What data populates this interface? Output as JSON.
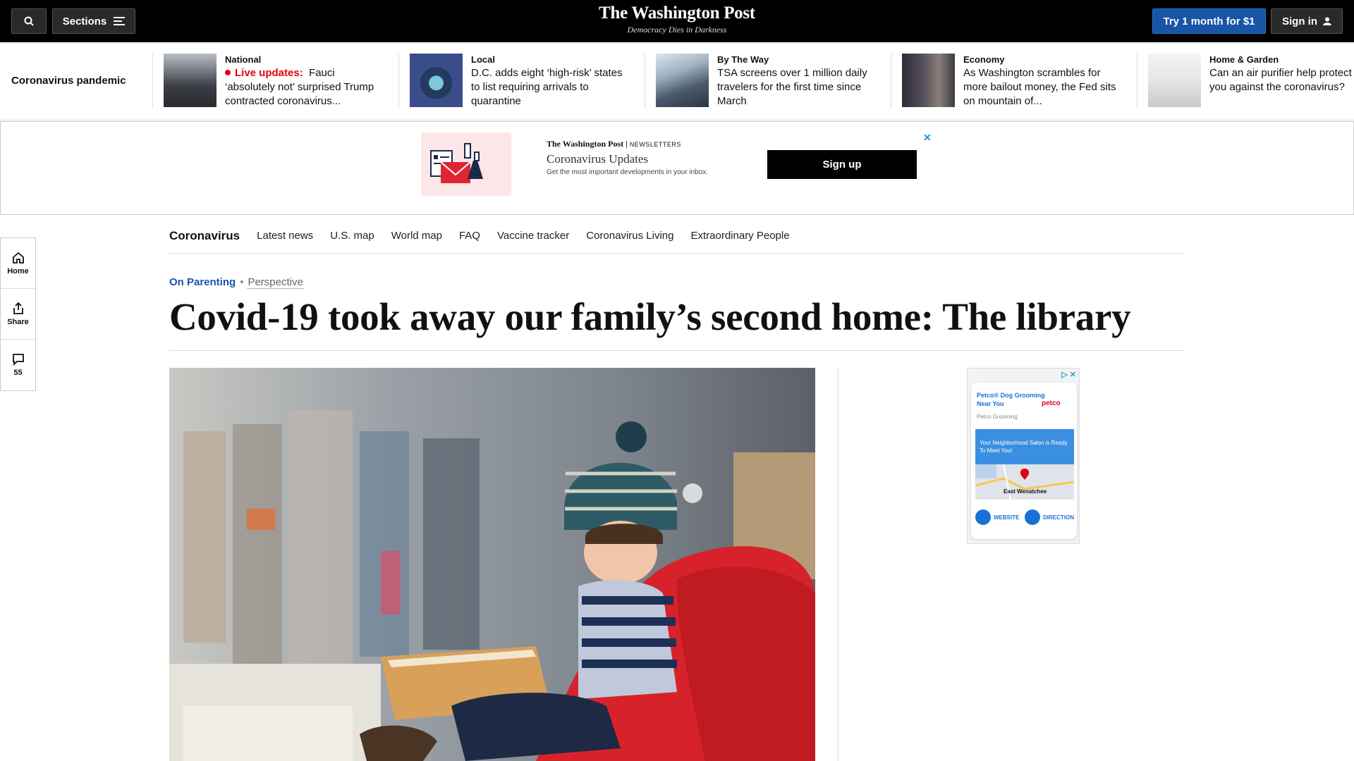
{
  "topbar": {
    "sections_label": "Sections",
    "logo": "The Washington Post",
    "tagline": "Democracy Dies in Darkness",
    "try_label": "Try 1 month for $1",
    "signin_label": "Sign in"
  },
  "strip": {
    "label": "Coronavirus pandemic",
    "items": [
      {
        "section": "National",
        "live": "Live updates:",
        "headline": "Fauci ‘absolutely not’ surprised Trump contracted coronavirus..."
      },
      {
        "section": "Local",
        "headline": "D.C. adds eight ‘high-risk’ states to list requiring arrivals to quarantine"
      },
      {
        "section": "By The Way",
        "headline": "TSA screens over 1 million daily travelers for the first time since March"
      },
      {
        "section": "Economy",
        "headline": "As Washington scrambles for more bailout money, the Fed sits on mountain of..."
      },
      {
        "section": "Home & Garden",
        "headline": "Can an air purifier help protect you against the coronavirus?"
      }
    ]
  },
  "newsletter": {
    "brand": "The Washington Post",
    "brand_sub": "NEWSLETTERS",
    "title": "Coronavirus Updates",
    "subtitle": "Get the most important developments in your inbox.",
    "button": "Sign up"
  },
  "secnav": {
    "home": "Coronavirus",
    "items": [
      "Latest news",
      "U.S. map",
      "World map",
      "FAQ",
      "Vaccine tracker",
      "Coronavirus Living",
      "Extraordinary People"
    ]
  },
  "rail": {
    "home": "Home",
    "share": "Share",
    "comments": "55"
  },
  "article": {
    "kicker": "On Parenting",
    "label": "Perspective",
    "headline": "Covid-19 took away our family’s second home: The library"
  },
  "ad": {
    "title": "Petco® Dog Grooming Near You",
    "logo": "petco",
    "advertiser": "Petco Grooming",
    "promo": "Your Neighborhood Salon is Ready To Meet You!",
    "map_label": "East Wenatchee",
    "website": "WEBSITE",
    "directions": "DIRECTIONS"
  },
  "colors": {
    "accent": "#1955a5",
    "live": "#e3000f",
    "topbar": "#000000"
  }
}
